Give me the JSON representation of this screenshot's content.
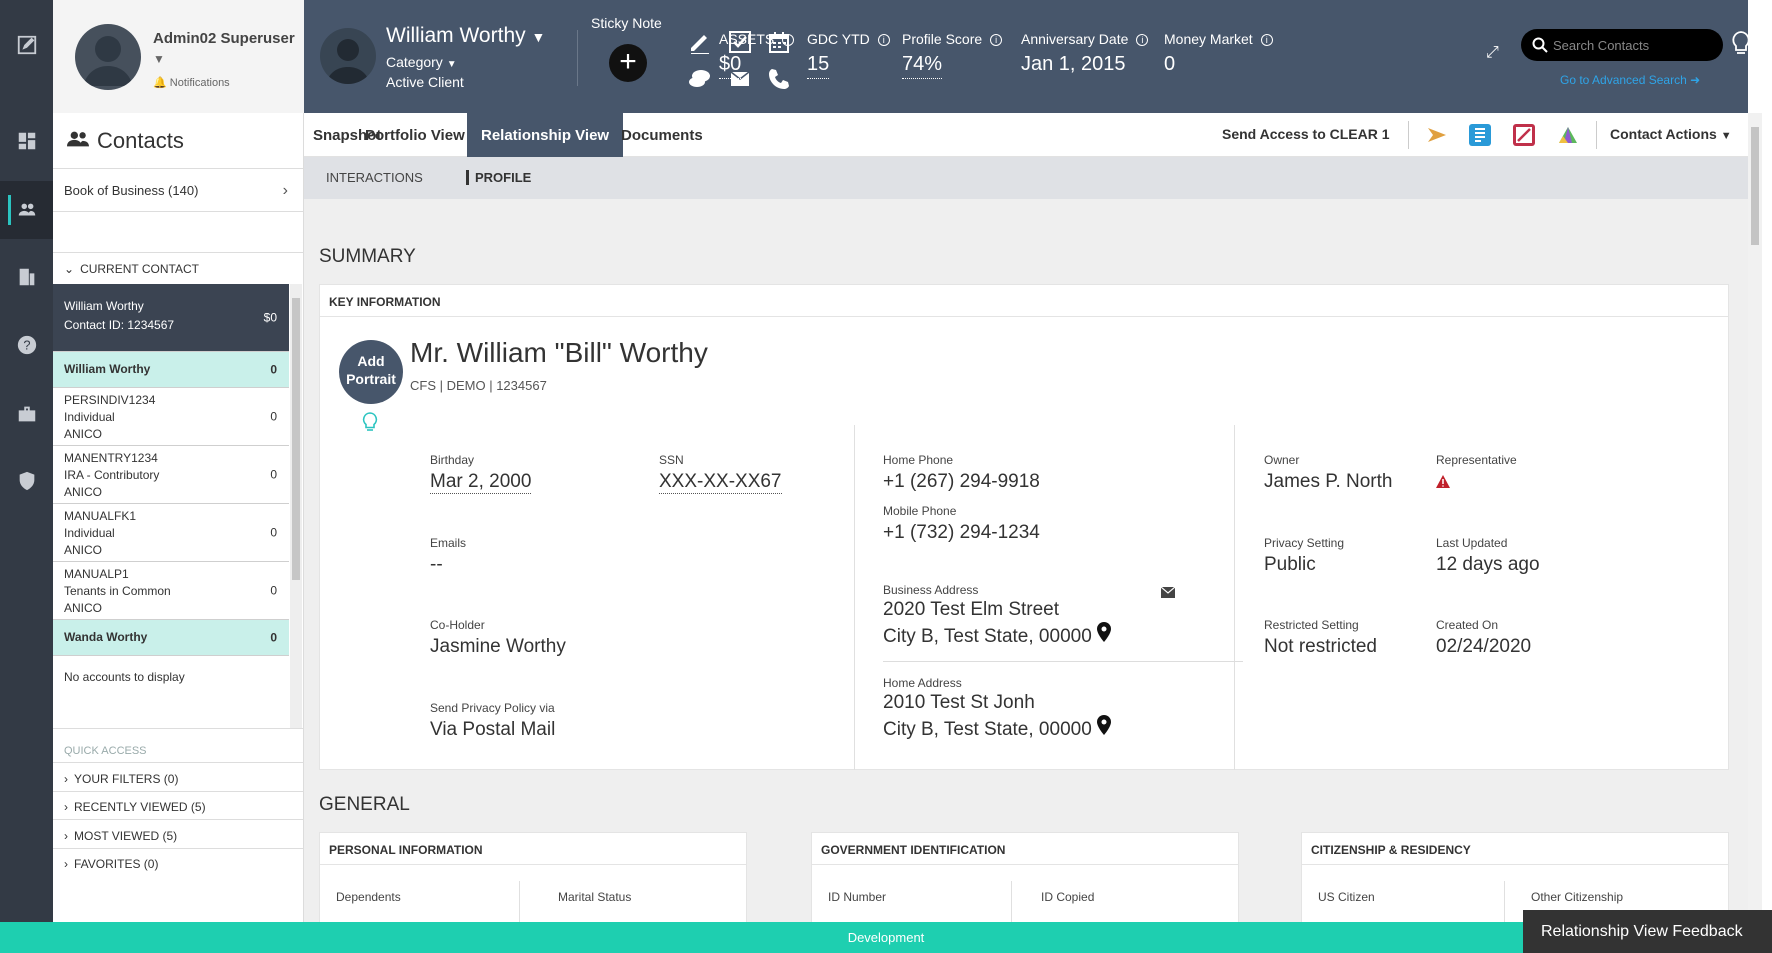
{
  "colors": {
    "header": "#47566b",
    "rail": "#333a45",
    "accent": "#1ecfb0",
    "highlight": "#c9f0ea"
  },
  "user": {
    "name": "Admin02 Superuser",
    "notifications": "Notifications"
  },
  "sidebar": {
    "title": "Contacts",
    "book": "Book of Business (140)",
    "current_contact": "CURRENT CONTACT",
    "current": {
      "name": "William Worthy",
      "id": "Contact ID: 1234567",
      "amount": "$0"
    },
    "accounts": [
      {
        "lines": [
          "William Worthy"
        ],
        "amount": "0",
        "style": "hl"
      },
      {
        "lines": [
          "PERSINDIV1234",
          "Individual",
          "ANICO"
        ],
        "amount": "0",
        "style": ""
      },
      {
        "lines": [
          "MANENTRY1234",
          "IRA - Contributory",
          "ANICO"
        ],
        "amount": "0",
        "style": ""
      },
      {
        "lines": [
          "MANUALFK1",
          "Individual",
          "ANICO"
        ],
        "amount": "0",
        "style": ""
      },
      {
        "lines": [
          "MANUALP1",
          "Tenants in Common",
          "ANICO"
        ],
        "amount": "0",
        "style": ""
      },
      {
        "lines": [
          "Wanda Worthy"
        ],
        "amount": "0",
        "style": "hl"
      }
    ],
    "no_accounts": "No accounts to display",
    "quick_access": "QUICK ACCESS",
    "quick_items": [
      "YOUR FILTERS (0)",
      "RECENTLY VIEWED (5)",
      "MOST VIEWED (5)",
      "FAVORITES (0)"
    ]
  },
  "header": {
    "contact_name": "William Worthy",
    "category": "Category",
    "status": "Active Client",
    "sticky_note": "Sticky Note",
    "stats": [
      {
        "label": "ASSETS",
        "value": "$0",
        "info": true,
        "underline": true
      },
      {
        "label": "GDC YTD",
        "value": "15",
        "info": true,
        "underline": true
      },
      {
        "label": "Profile Score",
        "value": "74%",
        "info": true,
        "underline": true
      },
      {
        "label": "Anniversary Date",
        "value": "Jan 1, 2015",
        "info": true,
        "underline": false
      },
      {
        "label": "Money Market",
        "value": "0",
        "info": true,
        "underline": false
      }
    ],
    "search_placeholder": "Search Contacts",
    "advanced_search": "Go to Advanced Search ➜"
  },
  "tabs": [
    "Snapshot",
    "Portfolio View",
    "Relationship View",
    "Documents"
  ],
  "active_tab": "Relationship View",
  "send_access": "Send Access to CLEAR 1",
  "contact_actions": "Contact Actions",
  "subtabs": [
    "INTERACTIONS",
    "PROFILE"
  ],
  "summary": {
    "title": "SUMMARY",
    "card_title": "KEY INFORMATION",
    "portrait": "Add Portrait",
    "full_name": "Mr. William \"Bill\" Worthy",
    "subline": "CFS | DEMO | 1234567",
    "birthday_label": "Birthday",
    "birthday": "Mar 2, 2000",
    "ssn_label": "SSN",
    "ssn": "XXX-XX-XX67",
    "emails_label": "Emails",
    "emails": "--",
    "coholder_label": "Co-Holder",
    "coholder": "Jasmine Worthy",
    "privacy_via_label": "Send Privacy Policy via",
    "privacy_via": "Via Postal Mail",
    "home_phone_label": "Home Phone",
    "home_phone": "+1 (267) 294-9918",
    "mobile_phone_label": "Mobile Phone",
    "mobile_phone": "+1 (732) 294-1234",
    "business_address_label": "Business Address",
    "business_address_1": "2020 Test Elm Street",
    "business_address_2": "City B, Test State, 00000",
    "home_address_label": "Home Address",
    "home_address_1": "2010 Test St Jonh",
    "home_address_2": "City B, Test State, 00000",
    "owner_label": "Owner",
    "owner": "James P. North",
    "representative_label": "Representative",
    "privacy_setting_label": "Privacy Setting",
    "privacy_setting": "Public",
    "last_updated_label": "Last Updated",
    "last_updated": "12 days ago",
    "restricted_label": "Restricted Setting",
    "restricted": "Not restricted",
    "created_label": "Created On",
    "created": "02/24/2020"
  },
  "general": {
    "title": "GENERAL",
    "personal": {
      "title": "PERSONAL INFORMATION",
      "fields": [
        "Dependents",
        "Marital Status"
      ]
    },
    "government": {
      "title": "GOVERNMENT IDENTIFICATION",
      "fields": [
        "ID Number",
        "ID Copied"
      ]
    },
    "citizenship": {
      "title": "CITIZENSHIP & RESIDENCY",
      "fields": [
        "US Citizen",
        "Other Citizenship"
      ]
    }
  },
  "footer": {
    "env": "Development",
    "feedback": "Relationship View Feedback"
  }
}
